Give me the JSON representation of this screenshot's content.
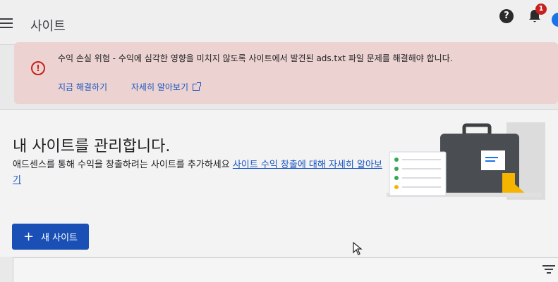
{
  "header": {
    "title": "사이트",
    "notification_count": "1",
    "help_symbol": "?"
  },
  "alert": {
    "message": "수익 손실 위험 - 수익에 심각한 영향을 미치지 않도록 사이트에서 발견된 ads.txt 파일 문제를 해결해야 합니다.",
    "action_fix": "지금 해결하기",
    "action_learn": "자세히 알아보기",
    "icon_symbol": "!"
  },
  "main": {
    "title": "내 사이트를 관리합니다.",
    "description": "애드센스를 통해 수익을 창출하려는 사이트를 추가하세요 ",
    "description_link": "사이트 수익 창출에 대해 자세히 알아보기",
    "new_site_plus": "+",
    "new_site_label": "새 사이트"
  },
  "colors": {
    "alert_bg": "#ecd2d0",
    "alert_icon": "#c5221f",
    "link": "#1a56c4",
    "primary_button": "#1a4fb5",
    "badge": "#c5221f"
  },
  "icons": [
    "menu-icon",
    "help-icon",
    "bell-icon",
    "alert-icon",
    "external-link-icon",
    "plus-icon",
    "filter-icon",
    "briefcase-illustration"
  ]
}
